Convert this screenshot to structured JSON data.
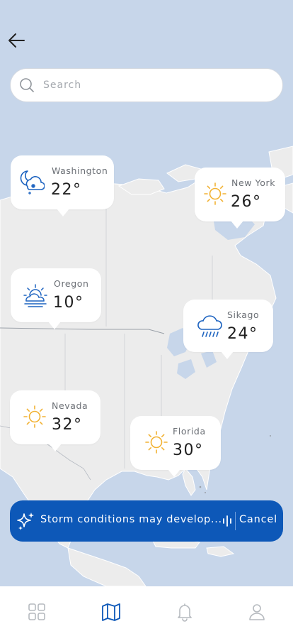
{
  "search": {
    "placeholder": "Search"
  },
  "cities": [
    {
      "city": "Washington",
      "temp": "22°",
      "icon": "moon-cloud-snow-icon"
    },
    {
      "city": "New York",
      "temp": "26°",
      "icon": "sun-icon"
    },
    {
      "city": "Oregon",
      "temp": "10°",
      "icon": "sun-cloud-icon"
    },
    {
      "city": "Sikago",
      "temp": "24°",
      "icon": "cloud-rain-icon"
    },
    {
      "city": "Nevada",
      "temp": "32°",
      "icon": "sun-icon"
    },
    {
      "city": "Florida",
      "temp": "30°",
      "icon": "sun-icon"
    }
  ],
  "alert": {
    "message": "Storm conditions may develop...",
    "cancel_label": "Cancel"
  },
  "nav": {
    "items": [
      "grid-icon",
      "map-icon",
      "bell-icon",
      "user-icon"
    ],
    "active": "map-icon"
  },
  "colors": {
    "accent": "#0d58b8",
    "sun": "#f2b233",
    "weather_icon_blue": "#1d63c0",
    "water": "#c7d6ea",
    "land": "#ececec"
  }
}
